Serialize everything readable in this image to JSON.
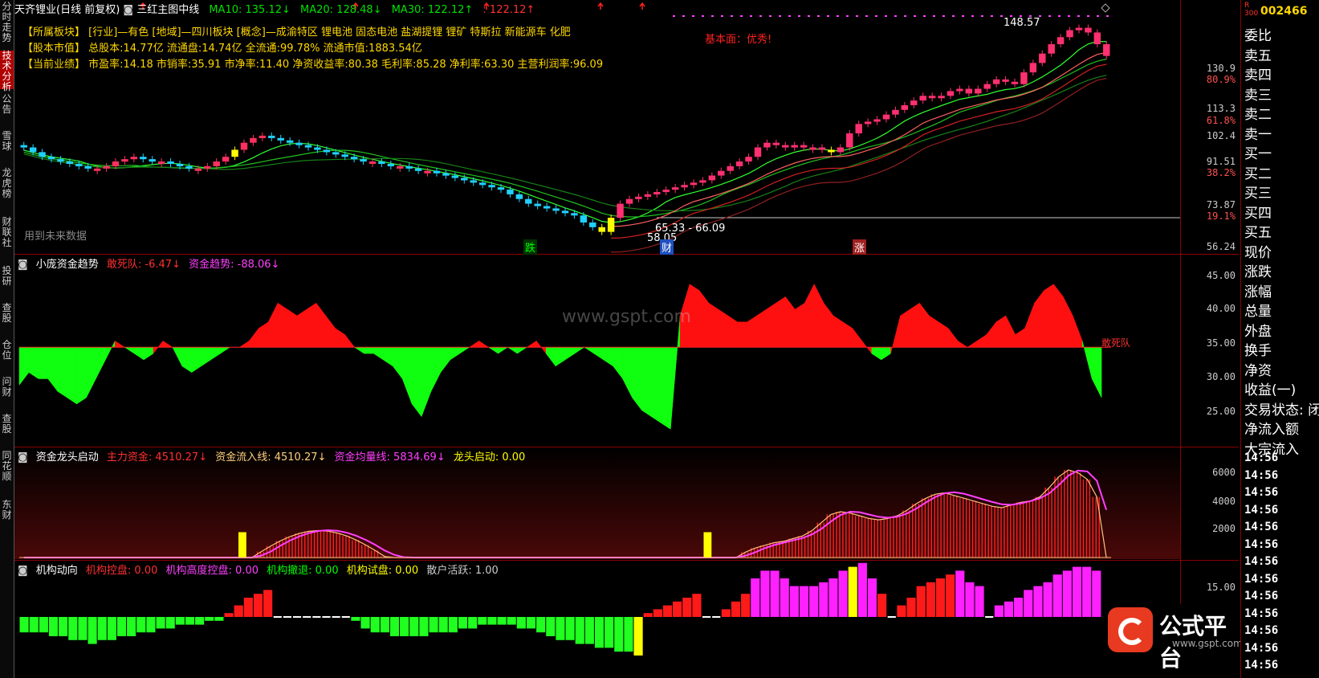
{
  "left_tabs": [
    {
      "label": "分时走势",
      "active": false
    },
    {
      "label": "技术分析",
      "active": true
    },
    {
      "label": "公告",
      "active": false
    },
    {
      "label": "雪球",
      "active": false
    },
    {
      "label": "龙虎榜",
      "active": false
    },
    {
      "label": "财联社",
      "active": false
    },
    {
      "label": "投研",
      "active": false
    },
    {
      "label": "查股",
      "active": false
    },
    {
      "label": "仓位",
      "active": false
    },
    {
      "label": "问财",
      "active": false
    },
    {
      "label": "查股",
      "active": false
    },
    {
      "label": "同花顺",
      "active": false
    },
    {
      "label": "东财",
      "active": false
    }
  ],
  "header": {
    "stock": "天齐锂业(日线 前复权)",
    "indicator": "三红主图中线",
    "ma10": "MA10: 135.12↓",
    "ma20": "MA20: 128.48↓",
    "ma30": "MA30: 122.12↑",
    "extra": ": 122.12↑"
  },
  "info": {
    "line1": "【所属板块】 [行业]—有色 [地域]—四川板块 [概念]—成渝特区 锂电池 固态电池 盐湖提锂 锂矿 特斯拉 新能源车 化肥",
    "line2": "【股本市值】 总股本:14.77亿 流通盘:14.74亿 全流通:99.78% 流通市值:1883.54亿",
    "line3": "【当前业绩】 市盈率:14.18 市销率:35.91 市净率:11.40 净资收益率:80.38 毛利率:85.28 净利率:63.30 主营利润率:96.09",
    "fundamental": "基本面：优秀!",
    "future_data": "用到未来数据",
    "high_label": "148.57",
    "low_label": "58.05",
    "range_label": "65.33 - 66.09",
    "die": "跌",
    "cai": "财",
    "zhang": "涨"
  },
  "main_scale": [
    "130.9",
    "80.9%",
    "113.3",
    "61.8%",
    "102.4",
    "91.51",
    "38.2%",
    "73.87",
    "19.1%",
    "56.24"
  ],
  "panel2": {
    "title": "小庞资金趋势",
    "a_label": "敢死队: -6.47↓",
    "b_label": "资金趋势: -88.06↓",
    "side_label": "敢死队",
    "scale": [
      "45.00",
      "40.00",
      "35.00",
      "30.00",
      "25.00"
    ]
  },
  "panel3": {
    "title": "资金龙头启动",
    "a": "主力资金: 4510.27↓",
    "b": "资金流入线: 4510.27↓",
    "c": "资金均量线: 5834.69↓",
    "d": "龙头启动: 0.00",
    "scale": [
      "6000",
      "4000",
      "2000"
    ]
  },
  "panel4": {
    "title": "机构动向",
    "a": "机构控盘: 0.00",
    "b": "机构高度控盘: 0.00",
    "c": "机构撤退: 0.00",
    "d": "机构试盘: 0.00",
    "e": "散户活跃: 1.00",
    "scale": [
      "15.00"
    ]
  },
  "watermark": "www.gspt.com",
  "logo": {
    "text": "公式平台",
    "url": "www.gspt.com"
  },
  "right_panel": {
    "code": "002466",
    "badge_r": "R",
    "badge_300": "300",
    "items": [
      "委比",
      "卖五",
      "卖四",
      "卖三",
      "卖二",
      "卖一",
      "买一",
      "买二",
      "买三",
      "买四",
      "买五",
      "现价",
      "涨跌",
      "涨幅",
      "总量",
      "外盘",
      "换手",
      "净资",
      "收益(一)",
      "交易状态: 闭",
      "净流入额",
      "大宗流入"
    ],
    "times": [
      "14:56",
      "14:56",
      "14:56",
      "14:56",
      "14:56",
      "14:56",
      "14:56",
      "14:56",
      "14:56",
      "14:56",
      "14:56",
      "14:56",
      "14:56"
    ]
  },
  "chart_data": [
    {
      "type": "candlestick",
      "title": "天齐锂业(日线 前复权)",
      "y_range": [
        56.24,
        148.57
      ],
      "closes": [
        96,
        94,
        92,
        91,
        90,
        89,
        88,
        87,
        87,
        88,
        90,
        91,
        92,
        91,
        90,
        90,
        89,
        88,
        87,
        87,
        88,
        90,
        92,
        95,
        98,
        100,
        101,
        100,
        99,
        98,
        97,
        96,
        95,
        94,
        93,
        92,
        91,
        90,
        90,
        89,
        88,
        88,
        87,
        86,
        86,
        85,
        84,
        83,
        82,
        81,
        80,
        79,
        78,
        76,
        74,
        72,
        71,
        70,
        69,
        68,
        67,
        64,
        62,
        60,
        66,
        72,
        74,
        75,
        76,
        77,
        78,
        79,
        80,
        81,
        82,
        84,
        86,
        88,
        90,
        92,
        96,
        98,
        97,
        96,
        97,
        96,
        96,
        95,
        94,
        96,
        102,
        106,
        107,
        108,
        110,
        112,
        114,
        116,
        118,
        117,
        118,
        120,
        121,
        119,
        121,
        123,
        125,
        124,
        123,
        128,
        132,
        136,
        140,
        143,
        146,
        147,
        145,
        140,
        135
      ],
      "special_yellow_idx": [
        23,
        63,
        64,
        88
      ]
    },
    {
      "type": "area",
      "title": "小庞资金趋势",
      "baseline": 35,
      "y_range": [
        20,
        47
      ],
      "values": [
        29,
        31,
        30,
        30,
        28,
        27,
        26,
        27,
        30,
        33,
        36,
        35,
        34,
        33,
        34,
        36,
        35,
        32,
        31,
        32,
        33,
        34,
        35,
        35,
        36,
        38,
        39,
        42,
        41,
        40,
        41,
        42,
        40,
        38,
        37,
        35,
        34,
        34,
        33,
        32,
        30,
        26,
        24,
        28,
        31,
        33,
        34,
        35,
        36,
        35,
        34,
        35,
        34,
        35,
        36,
        34,
        32,
        33,
        34,
        35,
        34,
        33,
        32,
        30,
        27,
        25,
        24,
        23,
        22,
        40,
        45,
        44,
        42,
        41,
        40,
        39,
        39,
        40,
        41,
        42,
        43,
        41,
        42,
        45,
        42,
        40,
        39,
        38,
        36,
        34,
        33,
        34,
        40,
        41,
        42,
        40,
        39,
        38,
        36,
        35,
        36,
        37,
        39,
        40,
        37,
        38,
        42,
        44,
        45,
        43,
        40,
        36,
        30,
        27
      ],
      "label": "敢死队"
    },
    {
      "type": "bar",
      "title": "资金龙头启动",
      "y_range": [
        0,
        6800
      ],
      "values": [
        0,
        0,
        0,
        0,
        0,
        0,
        0,
        0,
        0,
        0,
        0,
        0,
        0,
        0,
        0,
        0,
        0,
        0,
        0,
        0,
        0,
        0,
        0,
        0,
        0,
        0,
        0,
        0,
        0,
        0,
        0,
        0,
        0,
        0,
        0,
        0,
        0,
        0,
        0,
        0,
        0,
        0,
        0,
        0,
        0,
        0,
        0,
        0,
        0,
        0,
        0,
        0,
        0,
        0,
        0,
        0,
        0,
        0,
        0,
        0,
        0,
        0,
        0,
        0,
        0,
        0,
        0,
        0,
        0,
        0,
        0,
        0,
        0,
        0,
        0,
        0,
        0,
        0,
        0,
        0,
        0,
        0,
        0,
        0,
        0,
        0,
        0,
        0,
        0,
        0,
        0,
        0,
        0,
        0,
        0,
        0,
        0,
        0,
        0,
        0,
        0,
        0,
        0,
        0,
        0,
        0,
        0,
        0,
        0,
        0,
        0,
        0,
        0,
        0,
        0
      ],
      "hump1": {
        "from": 24,
        "to": 41,
        "peak": 2000
      },
      "hump2": {
        "from": 76,
        "to": 113,
        "levels": [
          400,
          700,
          900,
          1100,
          1200,
          1400,
          1600,
          2000,
          2600,
          3200,
          3400,
          3300,
          3100,
          2900,
          2800,
          2900,
          3100,
          3500,
          4000,
          4400,
          4700,
          4800,
          4600,
          4400,
          4200,
          4000,
          3800,
          3700,
          3900,
          4100,
          4200,
          4500,
          5200,
          6000,
          6500,
          6300,
          5800,
          4500
        ]
      },
      "yellow_idx": [
        23,
        72
      ],
      "series": [
        {
          "name": "主力资金",
          "last": 4510.27
        },
        {
          "name": "资金流入线",
          "last": 4510.27
        },
        {
          "name": "资金均量线",
          "last": 5834.69
        },
        {
          "name": "龙头启动",
          "last": 0
        }
      ]
    },
    {
      "type": "bar",
      "title": "机构动向",
      "values": [
        -4,
        -4,
        -4,
        -5,
        -5,
        -6,
        -6,
        -7,
        -6,
        -6,
        -5,
        -5,
        -4,
        -4,
        -3,
        -3,
        -2,
        -2,
        -2,
        -1,
        -1,
        1,
        3,
        5,
        6,
        7,
        0,
        0,
        0,
        0,
        0,
        0,
        0,
        0,
        -1,
        -3,
        -4,
        -4,
        -5,
        -5,
        -5,
        -5,
        -4,
        -4,
        -4,
        -3,
        -3,
        -2,
        -2,
        -2,
        -2,
        -3,
        -3,
        -4,
        -5,
        -6,
        -6,
        -7,
        -7,
        -8,
        -8,
        -9,
        -9,
        -10,
        1,
        2,
        3,
        4,
        5,
        6,
        0,
        0,
        2,
        4,
        6,
        10,
        12,
        12,
        10,
        8,
        8,
        8,
        9,
        10,
        12,
        13,
        14,
        10,
        6,
        0,
        3,
        5,
        8,
        9,
        10,
        11,
        12,
        9,
        8,
        0,
        3,
        4,
        5,
        7,
        8,
        9,
        11,
        12,
        13,
        13,
        12,
        0
      ],
      "color_rule": "green below 0, red rising, magenta institutional control",
      "series": [
        {
          "name": "机构控盘",
          "last": 0
        },
        {
          "name": "机构高度控盘",
          "last": 0
        },
        {
          "name": "机构撤退",
          "last": 0
        },
        {
          "name": "机构试盘",
          "last": 0
        },
        {
          "name": "散户活跃",
          "last": 1
        }
      ]
    }
  ]
}
